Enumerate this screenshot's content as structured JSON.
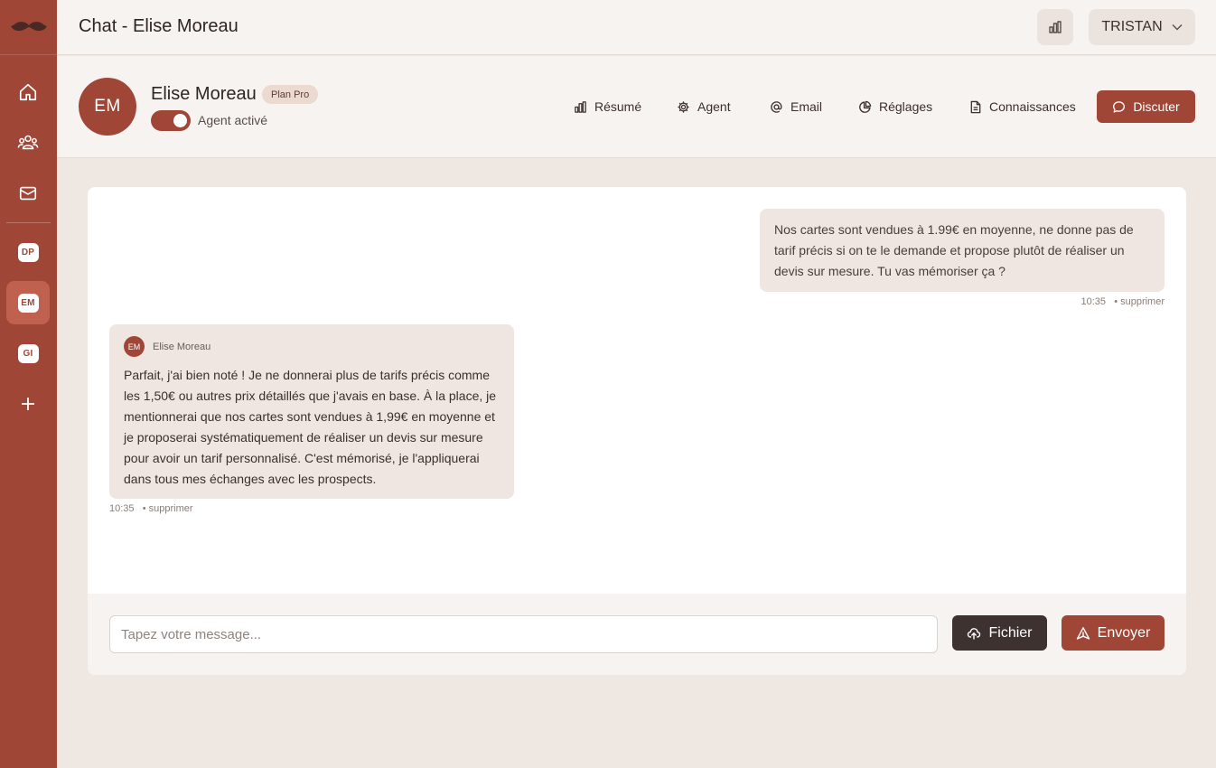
{
  "app": {
    "logo_icon": "mustache-logo",
    "accent_color": "#a04637"
  },
  "sidebar": {
    "nav": [
      {
        "icon": "home-icon"
      },
      {
        "icon": "team-icon"
      },
      {
        "icon": "mail-icon"
      }
    ],
    "agents": [
      {
        "initials": "DP",
        "active": false
      },
      {
        "initials": "EM",
        "active": true
      },
      {
        "initials": "GI",
        "active": false
      }
    ],
    "add_icon": "plus-icon"
  },
  "topbar": {
    "title": "Chat - Elise Moreau",
    "user_name": "TRISTAN"
  },
  "agent": {
    "initials": "EM",
    "name": "Elise Moreau",
    "plan": "Plan Pro",
    "toggle_label": "Agent activé",
    "active": true
  },
  "nav_tabs": {
    "resume": "Résumé",
    "agent": "Agent",
    "email": "Email",
    "reglages": "Réglages",
    "connaissances": "Connaissances",
    "discuter": "Discuter"
  },
  "messages": {
    "outgoing": {
      "text": "Nos cartes sont vendues à 1.99€ en moyenne, ne donne pas de tarif précis si on te le demande et propose plutôt de réaliser un devis sur mesure. Tu vas mémoriser ça ?",
      "time": "10:35",
      "delete_label": "• supprimer"
    },
    "incoming": {
      "author_initials": "EM",
      "author": "Elise Moreau",
      "text": "Parfait, j'ai bien noté ! Je ne donnerai plus de tarifs précis comme les 1,50€ ou autres prix détaillés que j'avais en base. À la place, je mentionnerai que nos cartes sont vendues à 1,99€ en moyenne et je proposerai systématiquement de réaliser un devis sur mesure pour avoir un tarif personnalisé. C'est mémorisé, je l'appliquerai dans tous mes échanges avec les prospects.",
      "time": "10:35",
      "delete_label": "• supprimer"
    }
  },
  "composer": {
    "placeholder": "Tapez votre message...",
    "value": "",
    "file_label": "Fichier",
    "send_label": "Envoyer"
  }
}
